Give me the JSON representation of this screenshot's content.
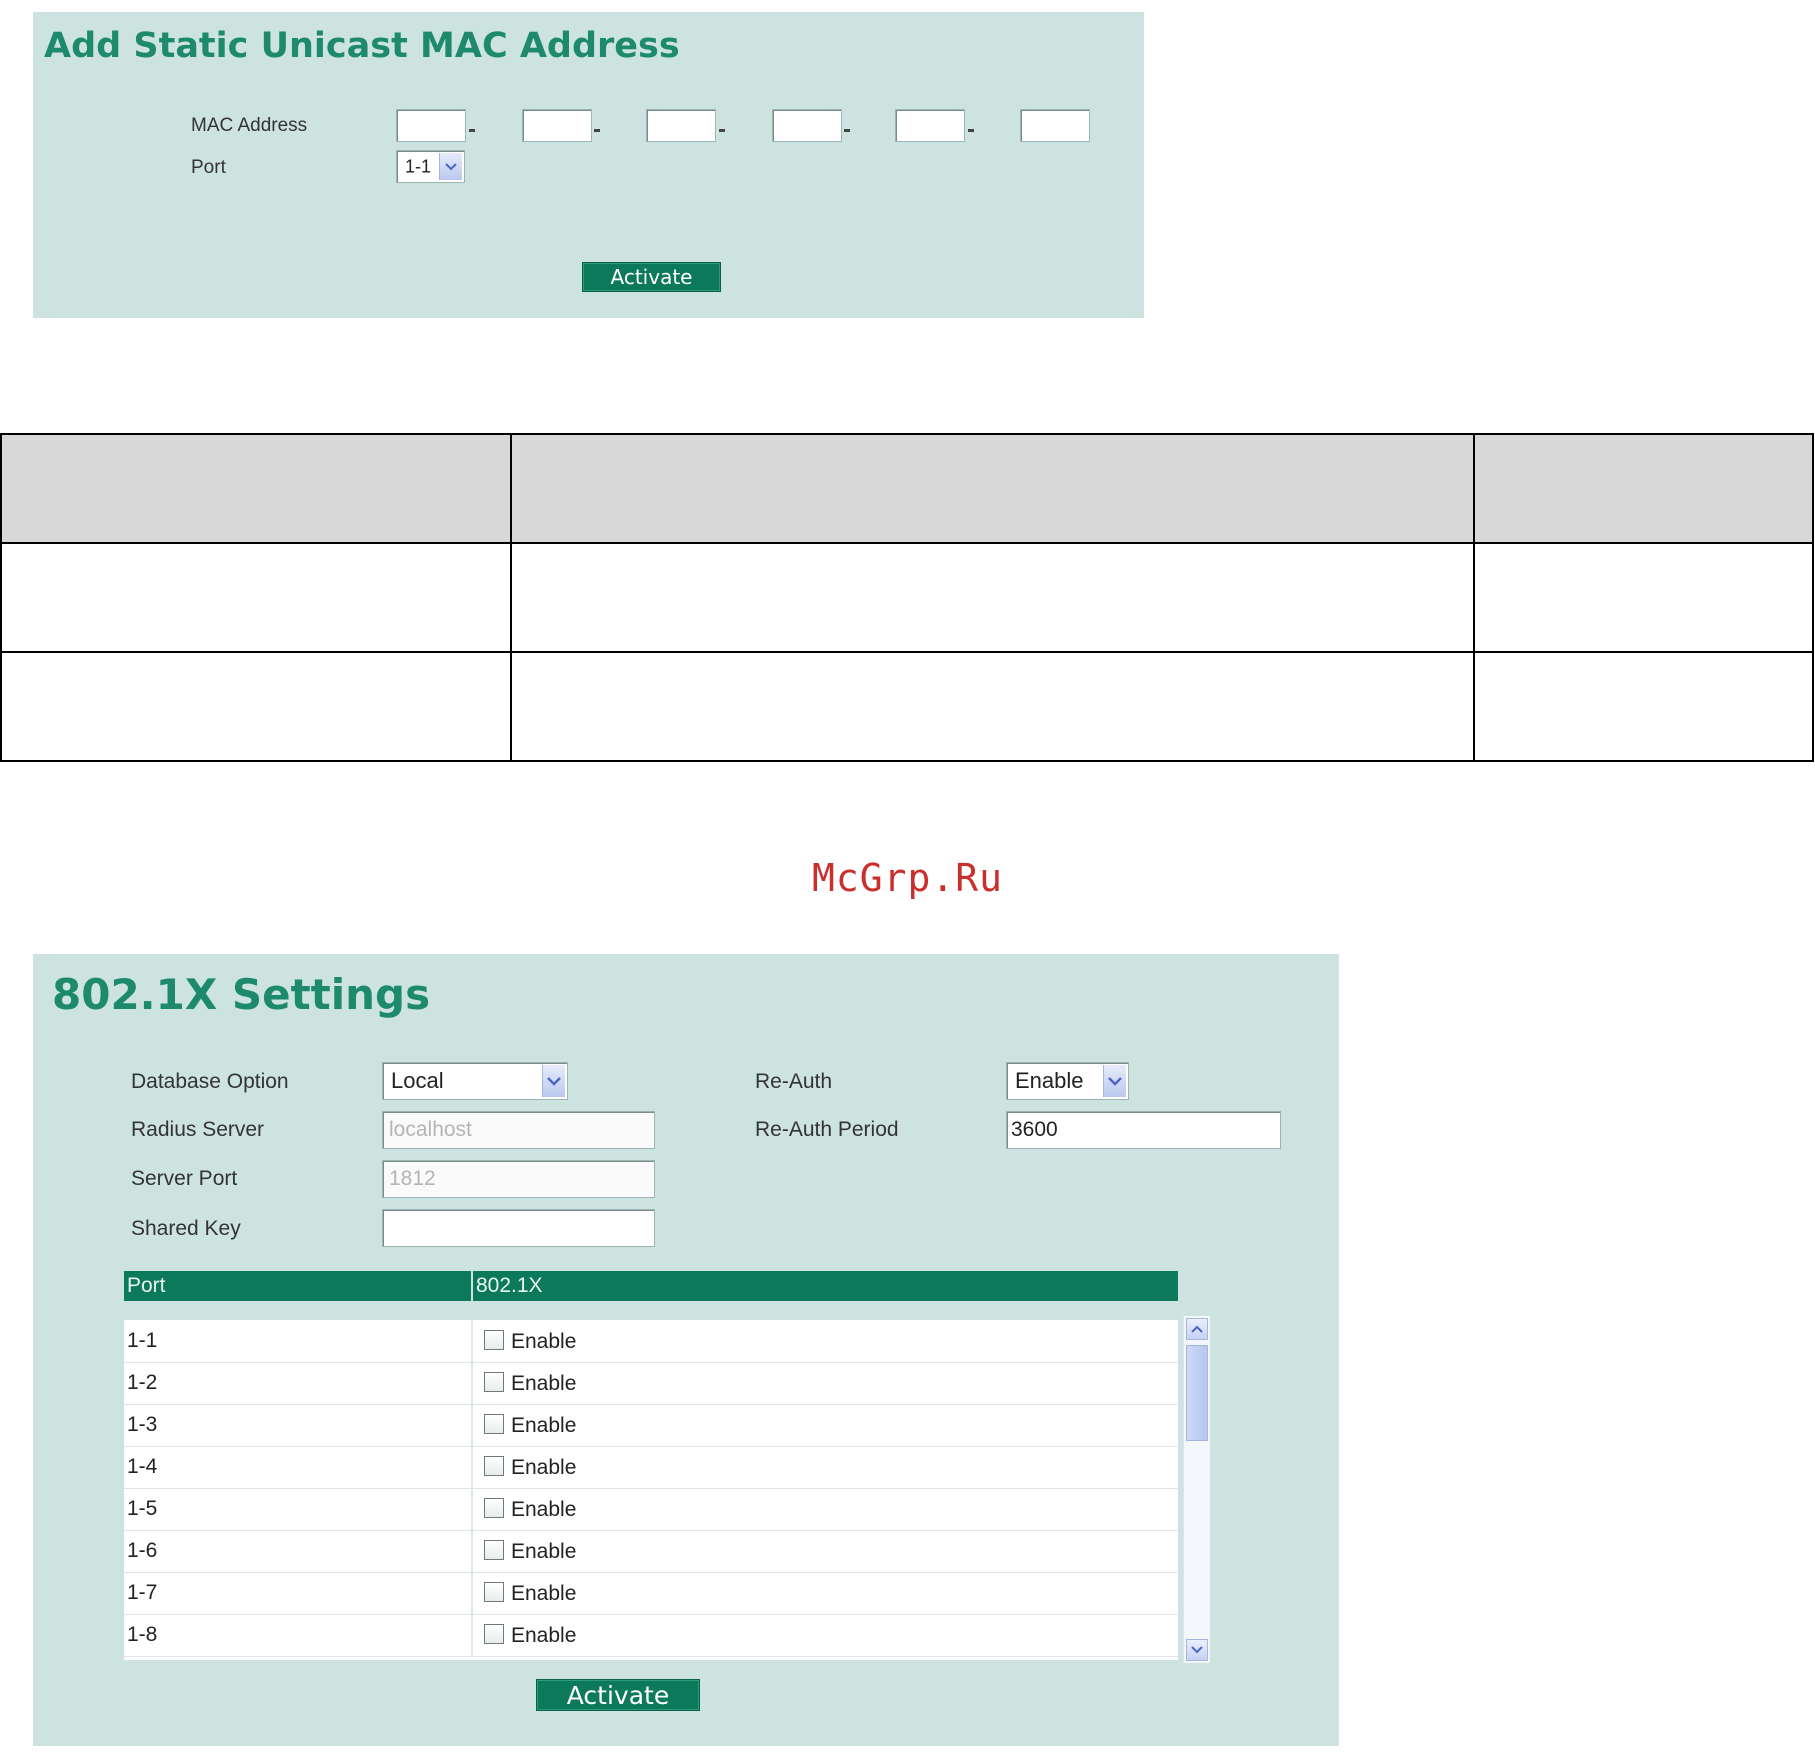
{
  "mac_panel": {
    "title": "Add Static Unicast MAC Address",
    "mac_label": "MAC Address",
    "port_label": "Port",
    "port_value": "1-1",
    "mac_octets": [
      "",
      "",
      "",
      "",
      "",
      ""
    ],
    "activate_label": "Activate"
  },
  "watermark": "McGrp.Ru",
  "dot1x_panel": {
    "title": "802.1X Settings",
    "database_option_label": "Database Option",
    "database_option_value": "Local",
    "radius_server_label": "Radius Server",
    "radius_server_value": "localhost",
    "server_port_label": "Server Port",
    "server_port_value": "1812",
    "shared_key_label": "Shared Key",
    "shared_key_value": "",
    "reauth_label": "Re-Auth",
    "reauth_value": "Enable",
    "reauth_period_label": "Re-Auth Period",
    "reauth_period_value": "3600",
    "table": {
      "col_port": "Port",
      "col_8021x": "802.1X",
      "rows": [
        {
          "port": "1-1",
          "label": "Enable"
        },
        {
          "port": "1-2",
          "label": "Enable"
        },
        {
          "port": "1-3",
          "label": "Enable"
        },
        {
          "port": "1-4",
          "label": "Enable"
        },
        {
          "port": "1-5",
          "label": "Enable"
        },
        {
          "port": "1-6",
          "label": "Enable"
        },
        {
          "port": "1-7",
          "label": "Enable"
        },
        {
          "port": "1-8",
          "label": "Enable"
        }
      ]
    },
    "activate_label": "Activate"
  }
}
